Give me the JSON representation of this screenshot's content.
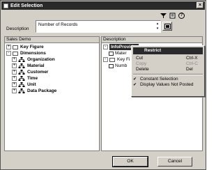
{
  "window": {
    "title": "Edit Selection"
  },
  "description": {
    "label": "Description",
    "value": "Number of Records"
  },
  "left_pane": {
    "header": "Sales Demo",
    "items": [
      {
        "label": "Key Figure",
        "type": "folder",
        "expander": "+"
      },
      {
        "label": "Dimensions",
        "type": "folder",
        "expander": "-"
      },
      {
        "label": "Organization",
        "type": "hierarchy",
        "expander": "+"
      },
      {
        "label": "Material",
        "type": "hierarchy",
        "expander": "+"
      },
      {
        "label": "Customer",
        "type": "hierarchy",
        "expander": "+"
      },
      {
        "label": "Time",
        "type": "hierarchy",
        "expander": "+"
      },
      {
        "label": "Unit",
        "type": "hierarchy",
        "expander": "+"
      },
      {
        "label": "Data Package",
        "type": "hierarchy",
        "expander": "+"
      }
    ]
  },
  "right_pane": {
    "header": "Description",
    "items": [
      {
        "label": "InfoProvider",
        "expander": "-"
      },
      {
        "label": "Mater"
      },
      {
        "label": "Key Fi",
        "expander": "-"
      },
      {
        "label": "Numb"
      }
    ]
  },
  "context_menu": {
    "header": "Restrict",
    "items": [
      {
        "label": "Cut",
        "shortcut": "Ctrl-X"
      },
      {
        "label": "Copy",
        "shortcut": "Ctrl-C"
      },
      {
        "label": "Delete",
        "shortcut": "Del"
      }
    ],
    "toggles": [
      {
        "label": "Constant Selection",
        "checked": "✔"
      },
      {
        "label": "Display Values Not Posted",
        "checked": "✔"
      }
    ]
  },
  "buttons": {
    "ok": "OK",
    "cancel": "Cancel"
  },
  "colors": {
    "titlebar": "#2a2a2a",
    "dialog_bg": "#d4d0c8"
  }
}
